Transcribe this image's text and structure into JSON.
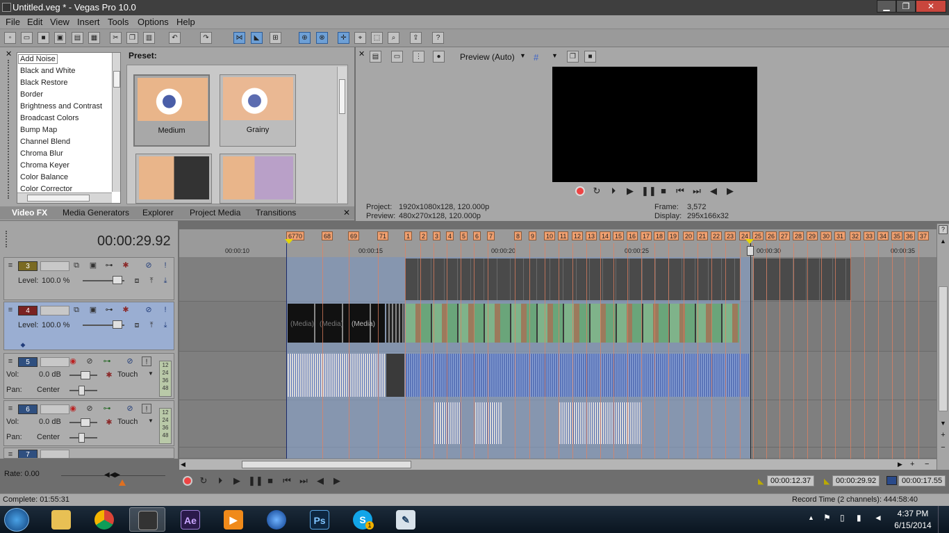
{
  "window": {
    "title": "Untitled.veg * - Vegas Pro 10.0",
    "min": "▁",
    "max": "❐",
    "close": "✕"
  },
  "menu": [
    "File",
    "Edit",
    "View",
    "Insert",
    "Tools",
    "Options",
    "Help"
  ],
  "fx": {
    "items": [
      "Add Noise",
      "Black and White",
      "Black Restore",
      "Border",
      "Brightness and Contrast",
      "Broadcast Colors",
      "Bump Map",
      "Channel Blend",
      "Chroma Blur",
      "Chroma Keyer",
      "Color Balance",
      "Color Corrector"
    ],
    "selected": "Add Noise",
    "preset_label": "Preset:",
    "presets": [
      "Medium",
      "Grainy"
    ]
  },
  "tabs": [
    "Video FX",
    "Media Generators",
    "Explorer",
    "Project Media",
    "Transitions"
  ],
  "preview": {
    "mode": "Preview (Auto)",
    "project_label": "Project:",
    "project": "1920x1080x128, 120.000p",
    "preview_label": "Preview:",
    "preview_value": "480x270x128, 120.000p",
    "frame_label": "Frame:",
    "frame": "3,572",
    "display_label": "Display:",
    "display": "295x166x32"
  },
  "timeline": {
    "cursor_time": "00:00:29.92",
    "markers": [
      "6770",
      "68",
      "69",
      "71",
      "1",
      "2",
      "3",
      "4",
      "5",
      "6",
      "7",
      "8",
      "9",
      "10",
      "11",
      "12",
      "13",
      "14",
      "15",
      "16",
      "17",
      "18",
      "19",
      "20",
      "21",
      "22",
      "23",
      "24",
      "25",
      "26",
      "27",
      "28",
      "29",
      "30",
      "31",
      "32",
      "33",
      "34",
      "35",
      "36",
      "37"
    ],
    "timecodes": [
      "00:00:10",
      "00:00:15",
      "00:00:20",
      "00:00:25",
      "00:00:30",
      "00:00:35"
    ],
    "media_label": "(Media)"
  },
  "tracks": [
    {
      "num": "3",
      "type": "video",
      "level_label": "Level:",
      "level": "100.0 %",
      "color": "#7a6a22"
    },
    {
      "num": "4",
      "type": "video",
      "level_label": "Level:",
      "level": "100.0 %",
      "color": "#7a2222"
    },
    {
      "num": "5",
      "type": "audio",
      "vol_label": "Vol:",
      "vol": "0.0 dB",
      "pan_label": "Pan:",
      "pan": "Center",
      "mode": "Touch",
      "color": "#2f4f7f",
      "meter": [
        "12",
        "24",
        "36",
        "48"
      ]
    },
    {
      "num": "6",
      "type": "audio",
      "vol_label": "Vol:",
      "vol": "0.0 dB",
      "pan_label": "Pan:",
      "pan": "Center",
      "mode": "Touch",
      "color": "#2f4f7f",
      "meter": [
        "12",
        "24",
        "36",
        "48"
      ]
    },
    {
      "num": "7",
      "type": "audio",
      "color": "#2f4f7f"
    }
  ],
  "rate": "Rate: 0.00",
  "transport_times": {
    "start": "00:00:12.37",
    "end": "00:00:29.92",
    "length": "00:00:17.55"
  },
  "status": {
    "complete": "Complete: 01:55:31",
    "record_time": "Record Time (2 channels): 444:58:40"
  },
  "taskbar": {
    "time": "4:37 PM",
    "date": "6/15/2014",
    "apps": [
      "start",
      "explorer",
      "chrome",
      "vegas",
      "after-effects",
      "media-player",
      "ie",
      "photoshop",
      "skype",
      "notepad"
    ],
    "ae_label": "Ae",
    "ps_label": "Ps",
    "skype_label": "S",
    "skype_badge": "1"
  }
}
